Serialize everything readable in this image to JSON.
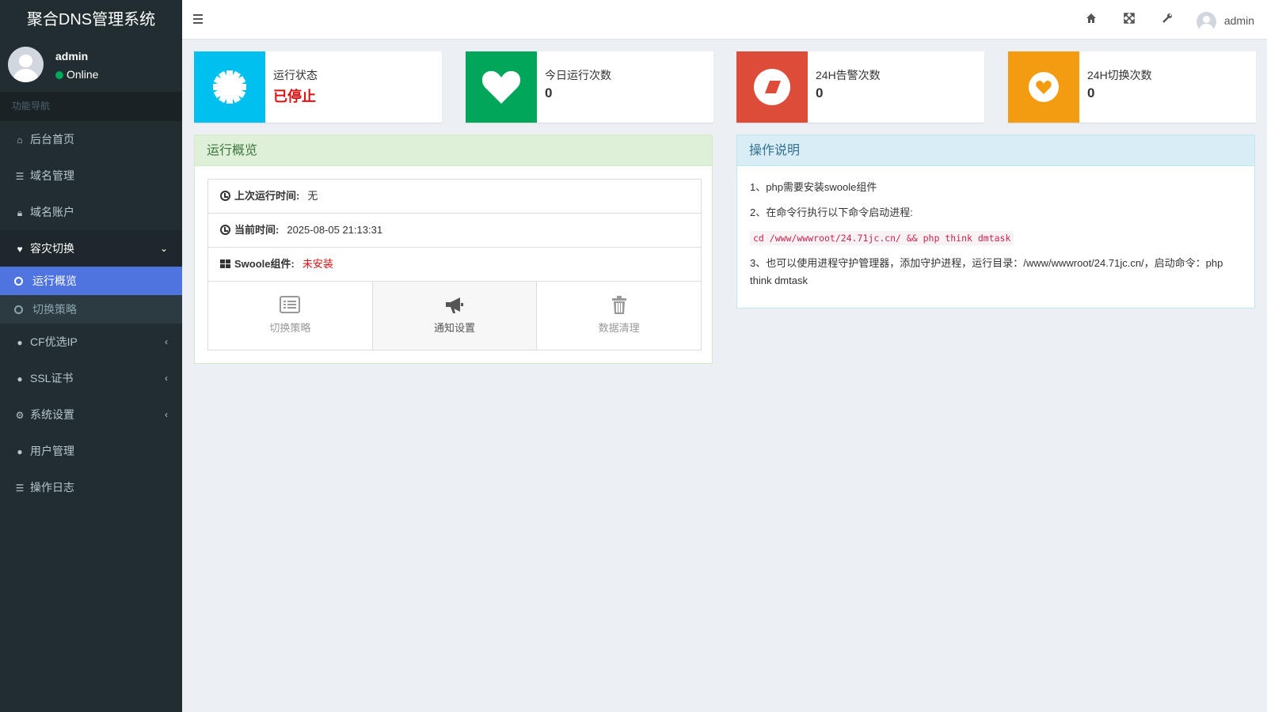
{
  "app": {
    "title": "聚合DNS管理系统"
  },
  "user": {
    "name": "admin",
    "status": "Online"
  },
  "sidebar": {
    "header": "功能导航",
    "items": [
      {
        "label": "后台首页",
        "icon": "home-icon"
      },
      {
        "label": "域名管理",
        "icon": "list-icon"
      },
      {
        "label": "域名账户",
        "icon": "lock-icon"
      },
      {
        "label": "容灾切换",
        "icon": "heartbeat-icon",
        "expanded": true,
        "children": [
          {
            "label": "运行概览",
            "active": true
          },
          {
            "label": "切换策略"
          }
        ]
      },
      {
        "label": "CF优选IP",
        "icon": "globe-icon"
      },
      {
        "label": "SSL证书",
        "icon": "lock-circle-icon"
      },
      {
        "label": "系统设置",
        "icon": "cogs-icon"
      },
      {
        "label": "用户管理",
        "icon": "user-icon"
      },
      {
        "label": "操作日志",
        "icon": "list-icon"
      }
    ]
  },
  "header": {
    "user": "admin"
  },
  "stats": [
    {
      "label": "运行状态",
      "value": "已停止",
      "color": "#00c0ef",
      "icon": "cog-icon"
    },
    {
      "label": "今日运行次数",
      "value": "0",
      "color": "#00a65a",
      "icon": "heart-icon"
    },
    {
      "label": "24H告警次数",
      "value": "0",
      "color": "#dd4b39",
      "icon": "eraser-icon"
    },
    {
      "label": "24H切换次数",
      "value": "0",
      "color": "#f39c12",
      "icon": "heart-circle-icon"
    }
  ],
  "overview": {
    "title": "运行概览",
    "last_run_label": "上次运行时间:",
    "last_run_value": "无",
    "now_label": "当前时间:",
    "now_value": "2025-08-05 21:13:31",
    "swoole_label": "Swoole组件:",
    "swoole_value": "未安装",
    "buttons": [
      {
        "label": "切换策略"
      },
      {
        "label": "通知设置"
      },
      {
        "label": "数据清理"
      }
    ]
  },
  "help": {
    "title": "操作说明",
    "line1": "1、php需要安装swoole组件",
    "line2": "2、在命令行执行以下命令启动进程:",
    "command": "cd /www/wwwroot/24.71jc.cn/ && php think dmtask",
    "line3": "3、也可以使用进程守护管理器，添加守护进程，运行目录：/www/wwwroot/24.71jc.cn/，启动命令：php think dmtask"
  }
}
